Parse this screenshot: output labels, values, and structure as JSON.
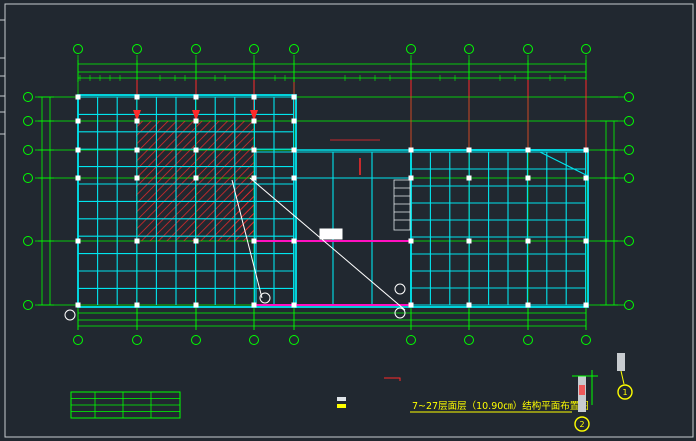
{
  "drawing": {
    "title": "7~27层面层（10.90㎝）结构平面布置图",
    "colors": {
      "background": "#212830",
      "frame": "#c8ccd0",
      "grid": "#00ff00",
      "beam": "#00e5ee",
      "red": "#ff2a2a",
      "magenta": "#ff10c0",
      "white": "#ffffff",
      "yellow": "#ffff00"
    },
    "legend_table": {
      "rows": 4,
      "cols": 4
    },
    "markers": [
      "1",
      "2"
    ]
  }
}
